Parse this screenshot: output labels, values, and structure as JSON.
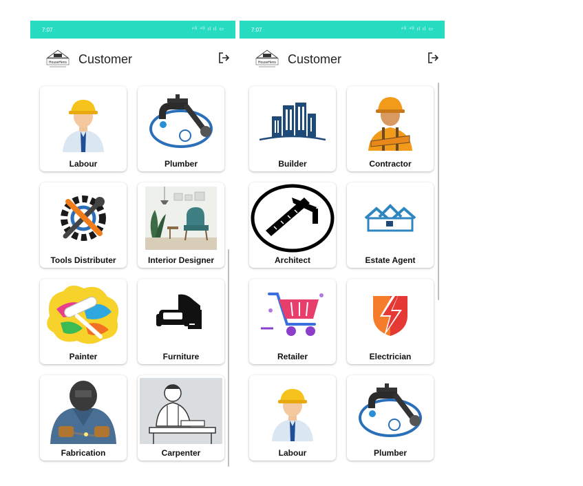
{
  "screens": [
    {
      "status_time": "7:07",
      "status_icons": "⁴ᴳ ⁴ᴳ ıl ıl ▭",
      "title": "Customer",
      "logo_text": "HouseHens",
      "cards": [
        {
          "label": "Labour",
          "icon": "labour-icon"
        },
        {
          "label": "Plumber",
          "icon": "plumber-icon"
        },
        {
          "label": "Tools Distributer",
          "icon": "tools-icon"
        },
        {
          "label": "Interior Designer",
          "icon": "interior-icon"
        },
        {
          "label": "Painter",
          "icon": "painter-icon"
        },
        {
          "label": "Furniture",
          "icon": "furniture-icon"
        },
        {
          "label": "Fabrication",
          "icon": "welder-icon"
        },
        {
          "label": "Carpenter",
          "icon": "carpenter-icon"
        }
      ]
    },
    {
      "status_time": "7:07",
      "status_icons": "⁴ᴳ ⁴ᴳ ıl ıl ▭",
      "title": "Customer",
      "logo_text": "HouseHens",
      "cards": [
        {
          "label": "Builder",
          "icon": "building-icon"
        },
        {
          "label": "Contractor",
          "icon": "contractor-icon"
        },
        {
          "label": "Architect",
          "icon": "architect-icon"
        },
        {
          "label": "Estate Agent",
          "icon": "house-icon"
        },
        {
          "label": "Retailer",
          "icon": "cart-icon"
        },
        {
          "label": "Electrician",
          "icon": "lightning-icon"
        },
        {
          "label": "Labour",
          "icon": "labour-icon"
        },
        {
          "label": "Plumber",
          "icon": "plumber-icon"
        }
      ]
    }
  ],
  "colors": {
    "status_bar": "#27dcc0",
    "building_blue": "#1e4a7a",
    "estate_blue": "#2e86c1",
    "electric_red": "#e53935"
  }
}
